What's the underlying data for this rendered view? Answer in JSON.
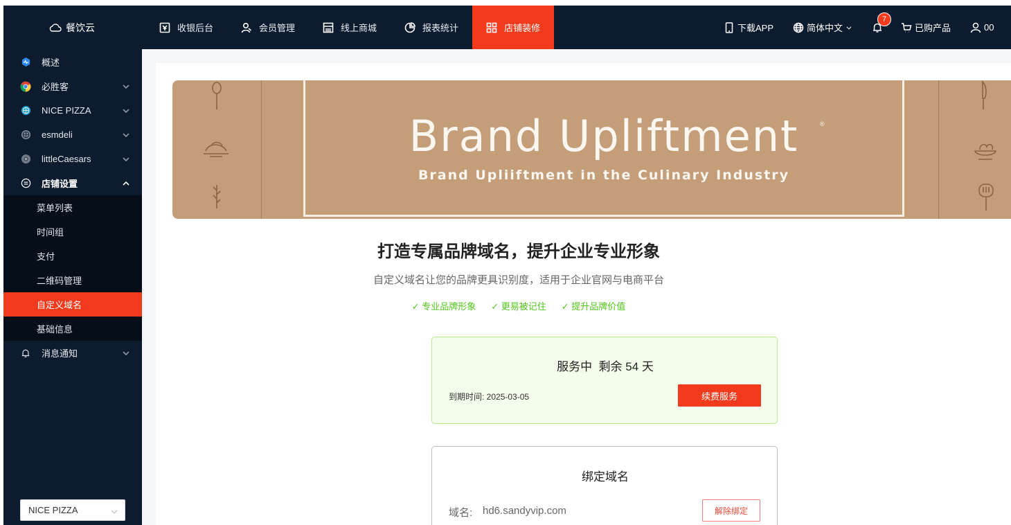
{
  "app": {
    "logo_text": "餐饮云"
  },
  "nav": [
    {
      "label": "收银后台",
      "icon": "cashier-icon"
    },
    {
      "label": "会员管理",
      "icon": "member-icon"
    },
    {
      "label": "线上商城",
      "icon": "store-icon"
    },
    {
      "label": "报表统计",
      "icon": "pie-chart-icon"
    },
    {
      "label": "店铺装修",
      "icon": "grid-icon",
      "active": true
    }
  ],
  "tools": {
    "download": "下载APP",
    "language": "简体中文",
    "notifications": "7",
    "products": "已购产品",
    "user": "00"
  },
  "sidebar": {
    "items": [
      {
        "label": "概述"
      },
      {
        "label": "必胜客"
      },
      {
        "label": "NICE PIZZA"
      },
      {
        "label": "esmdeli"
      },
      {
        "label": "littleCaesars"
      },
      {
        "label": "店铺设置"
      }
    ],
    "sub_items": [
      {
        "label": "菜单列表"
      },
      {
        "label": "时间组"
      },
      {
        "label": "支付"
      },
      {
        "label": "二维码管理"
      },
      {
        "label": "自定义域名",
        "active": true
      },
      {
        "label": "基础信息"
      }
    ],
    "notice": "消息通知",
    "store_select": "NICE PIZZA"
  },
  "banner": {
    "title": "Brand Upliftment",
    "subtitle": "Brand Upliiftment in the Culinary Industry",
    "reg_mark": "®"
  },
  "content": {
    "headline": "打造专属品牌域名，提升企业专业形象",
    "subline": "自定义域名让您的品牌更具识别度，适用于企业官网与电商平台",
    "features": [
      "✓ 专业品牌形象",
      "✓ 更易被记住",
      "✓ 提升品牌价值"
    ]
  },
  "service": {
    "status": "服务中  剩余 54 天",
    "expire": "到期时间: 2025-03-05",
    "renew_label": "续费服务"
  },
  "domain": {
    "title": "绑定域名",
    "label": "域名:",
    "value": "hd6.sandyvip.com",
    "unbind_label": "解除绑定"
  },
  "colors": {
    "accent": "#f23b1c",
    "nav_bg": "#0d1b2e",
    "banner": "#c49d79",
    "success": "#52c41a"
  }
}
